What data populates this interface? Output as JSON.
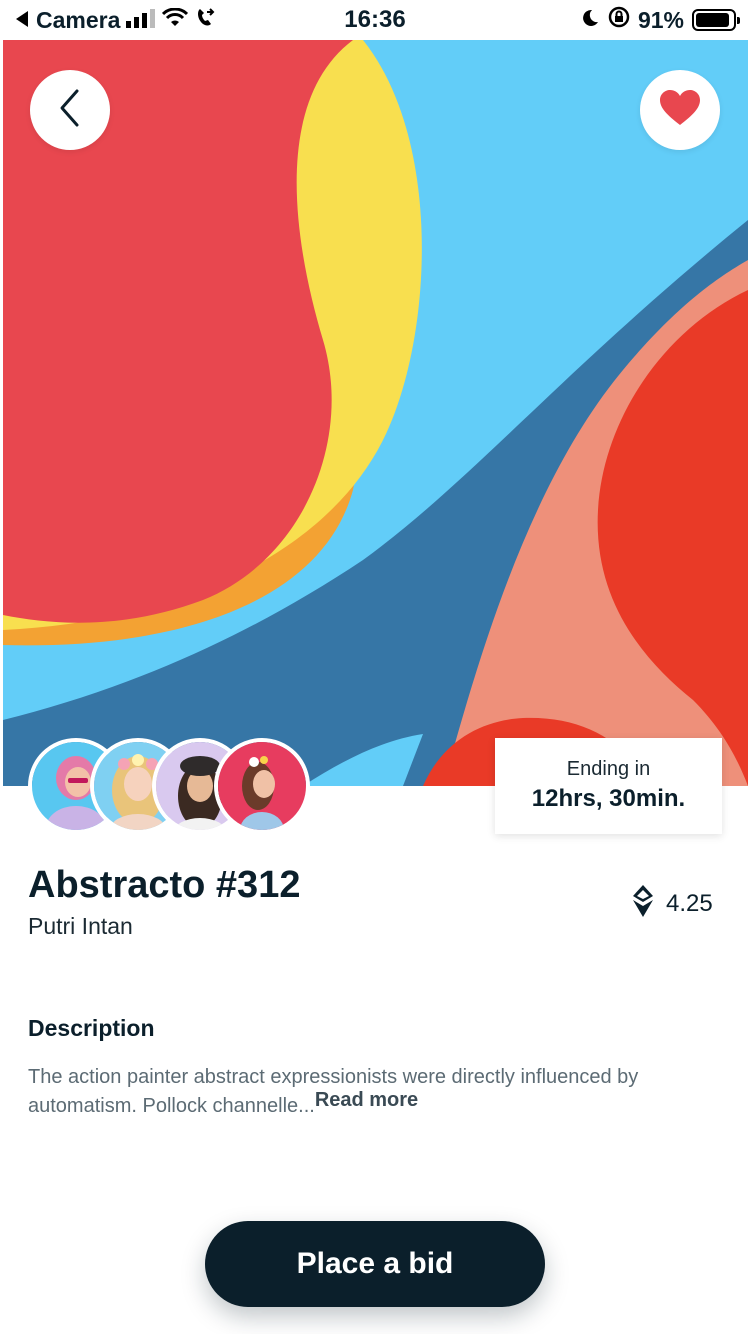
{
  "status_bar": {
    "back_app": "Camera",
    "time": "16:36",
    "battery": "91%",
    "battery_level": 0.91
  },
  "artwork": {
    "title": "Abstracto #312",
    "artist": "Putri Intan",
    "price": "4.25",
    "price_icon": "ethereum-icon"
  },
  "ending": {
    "label": "Ending in",
    "value": "12hrs, 30min."
  },
  "bidders": [
    {
      "name": "bidder-1",
      "bg": "#58c7f0"
    },
    {
      "name": "bidder-2",
      "bg": "#7fd0f2"
    },
    {
      "name": "bidder-3",
      "bg": "#d9c9ef"
    },
    {
      "name": "bidder-4",
      "bg": "#e73c5f"
    }
  ],
  "description": {
    "heading": "Description",
    "text": "The action painter abstract expressionists were directly influenced by automatism. Pollock channelle...",
    "read_more": "Read more"
  },
  "actions": {
    "place_bid": "Place a bid"
  },
  "colors": {
    "primary": "#0b1f2b",
    "hero_red": "#e8474f",
    "hero_yellow": "#f8df4f",
    "hero_sky": "#62cdf8",
    "hero_blue": "#3676a6",
    "hero_salmon": "#ee907a",
    "hero_orange_red": "#e93a27",
    "heart": "#e8474f"
  }
}
